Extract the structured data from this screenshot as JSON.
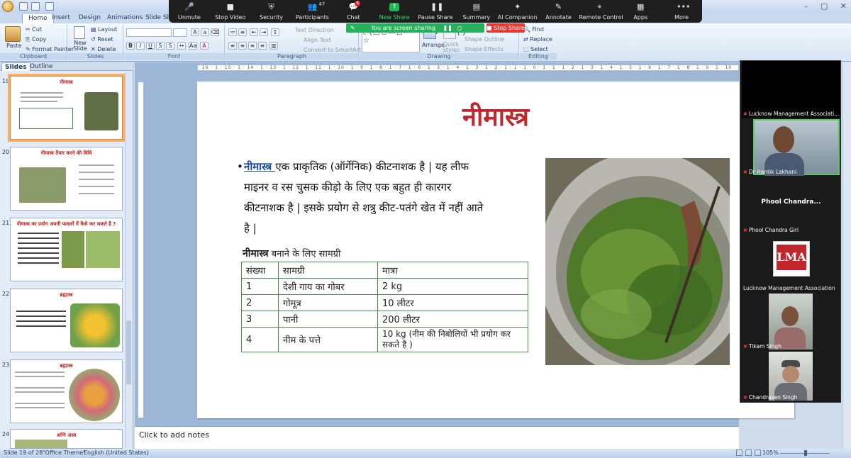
{
  "ppt": {
    "tabs": [
      "Home",
      "Insert",
      "Design",
      "Animations",
      "Slide Show"
    ],
    "clipboard": {
      "paste": "Paste",
      "cut": "Cut",
      "copy": "Copy",
      "format_painter": "Format Painter",
      "label": "Clipboard"
    },
    "slides_grp": {
      "new_slide": "New Slide",
      "layout": "Layout",
      "reset": "Reset",
      "delete": "Delete",
      "label": "Slides"
    },
    "font_grp": {
      "label": "Font"
    },
    "para_grp": {
      "text_direction": "Text Direction",
      "align_text": "Align Text",
      "convert": "Convert to SmartArt",
      "label": "Paragraph"
    },
    "drawing_grp": {
      "arrange": "Arrange",
      "quick_styles": "Quick Styles",
      "shape_outline": "Shape Outline",
      "shape_effects": "Shape Effects",
      "label": "Drawing"
    },
    "editing_grp": {
      "find": "Find",
      "replace": "Replace",
      "select": "Select",
      "label": "Editing"
    },
    "panel_tabs": [
      "Slides",
      "Outline"
    ],
    "ruler_text": "· 16 · 1 · 15 · 1 · 14 · 1 · 13 · 1 · 12 · 1 · 11 · 1 · 10 · 1 · 9 · 1 · 8 · 1 · 7 · 1 · 6 · 1 · 5 · 1 · 4 · 1 · 3 · 1 · 2 · 1 · 1 · 1 · 0 · 1 · 1 · 1 · 2 · 1 · 3 · 1 · 4 · 1 · 5 · 1 · 6 · 1 · 7 · 1 · 8 · 1 · 9 · 1 · 10 · 1 · 11 · 1 · 12 · 1 · 13 · 1 · 14 · 1 · 15 · 1 · 16",
    "thumbnails": [
      {
        "num": "19",
        "title": "नीमास्त्र"
      },
      {
        "num": "20",
        "title": "नीमास्त्र तैयार करने की विधि"
      },
      {
        "num": "21",
        "title": "नीमास्त्र का प्रयोग अपनी फसलों में कैसे कर सकते है ?"
      },
      {
        "num": "22",
        "title": "ब्रह्मास्त्र"
      },
      {
        "num": "23",
        "title": "ब्रह्मास्त्र"
      },
      {
        "num": "24",
        "title": "अग्नि अस्त्र"
      }
    ],
    "slide": {
      "title": "नीमास्त्र",
      "bullet_link": "नीमास्त्र ",
      "bullet_text": "एक प्राकृतिक (ऑर्गेनिक) कीटनाशक है | यह लीफ माइनर व रस चुसक कीड़ो के लिए एक बहुत ही कारगर कीटनाशक है | इसके प्रयोग से शत्रु कीट-पतंगे खेत में नहीं आते है |",
      "subhead_bold": "नीमास्त्र",
      "subhead_rest": "  बनाने के लिए सामग्री",
      "table_header": [
        "संख्या",
        "सामग्री",
        "मात्रा"
      ],
      "table_rows": [
        [
          "1",
          "देशी गाय का गोबर",
          "2 kg"
        ],
        [
          "2",
          "गोमूत्र",
          "10 लीटर"
        ],
        [
          "3",
          "पानी",
          "200 लीटर"
        ],
        [
          "4",
          "नीम के पत्ते",
          "10 kg (नीम की निबोलियों भी प्रयोग कर सकते है )"
        ]
      ]
    },
    "notes_placeholder": "Click to add notes",
    "status": {
      "slide_of": "Slide 19 of 28",
      "theme": "\"Office Theme\"",
      "lang": "English (United States)",
      "zoom": "105%"
    }
  },
  "zoom": {
    "toolbar": [
      {
        "icon": "mic-off-icon",
        "glyph": "🎤",
        "label": "Unmute"
      },
      {
        "icon": "video-icon",
        "glyph": "■",
        "label": "Stop Video"
      },
      {
        "icon": "shield-icon",
        "glyph": "⛨",
        "label": "Security"
      },
      {
        "icon": "participants-icon",
        "glyph": "👥",
        "label": "Participants",
        "count": "47"
      },
      {
        "icon": "chat-icon",
        "glyph": "💬",
        "label": "Chat",
        "badge": "6"
      },
      {
        "icon": "new-share-icon",
        "glyph": "↑",
        "label": "New Share",
        "green": true
      },
      {
        "icon": "pause-icon",
        "glyph": "❚❚",
        "label": "Pause Share"
      },
      {
        "icon": "summary-icon",
        "glyph": "▤",
        "label": "Summary"
      },
      {
        "icon": "ai-companion-icon",
        "glyph": "✦",
        "label": "AI Companion"
      },
      {
        "icon": "annotate-icon",
        "glyph": "✎",
        "label": "Annotate"
      },
      {
        "icon": "remote-control-icon",
        "glyph": "⌖",
        "label": "Remote Control"
      },
      {
        "icon": "apps-icon",
        "glyph": "▦",
        "label": "Apps"
      },
      {
        "icon": "more-icon",
        "glyph": "•••",
        "label": "More"
      }
    ],
    "share_banner": "You are screen sharing",
    "stop_share": "Stop Share",
    "participants": [
      {
        "name": "Lucknow Management Associati...",
        "kind": "blank"
      },
      {
        "name": "Dr  Hardik Lakhani",
        "kind": "video"
      },
      {
        "name": "Phool Chandra Giri",
        "kind": "text",
        "display": "Phool  Chandra..."
      },
      {
        "name": "Lucknow Management Association",
        "kind": "logo",
        "logo": "LMA"
      },
      {
        "name": "Tikam Singh",
        "kind": "video"
      },
      {
        "name": "Chandrasen Singh",
        "kind": "video"
      }
    ]
  }
}
